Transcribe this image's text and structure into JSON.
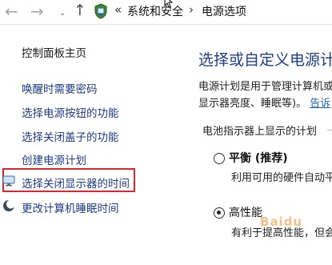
{
  "address_bar": {
    "back_glyph": "←",
    "forward_glyph": "→",
    "recent_glyph": "⌄",
    "up_glyph": "↑",
    "location_icon": "control-panel-shield-icon",
    "overflow_glyph": "«",
    "crumbs": [
      "系统和安全",
      "电源选项"
    ],
    "separator_glyph": "›"
  },
  "sidebar": {
    "home_label": "控制面板主页",
    "items": [
      {
        "label": "唤醒时需要密码"
      },
      {
        "label": "选择电源按钮的功能"
      },
      {
        "label": "选择关闭盖子的功能"
      },
      {
        "label": "创建电源计划"
      },
      {
        "label": "选择关闭显示器的时间",
        "icon": "display-monitor-icon",
        "highlighted": true
      },
      {
        "label": "更改计算机睡眠时间",
        "icon": "sleep-moon-icon"
      }
    ]
  },
  "main": {
    "title": "选择或自定义电源计",
    "desc_line1": "电源计划是用于管理计算机或",
    "desc_line2": "显示器亮度、睡眠等)。",
    "desc_link": "告诉",
    "plans_header": "电池指示器上显示的计划",
    "plans": [
      {
        "name": "平衡 (推荐)",
        "selected": false,
        "description": "利用可用的硬件自动平"
      },
      {
        "name": "高性能",
        "selected": true,
        "description": "有利于提高性能，但会"
      }
    ]
  },
  "watermark": "Baidu",
  "colors": {
    "highlight_border": "#e0242f",
    "link": "#1d3b8a",
    "title": "#1f3e8a"
  }
}
